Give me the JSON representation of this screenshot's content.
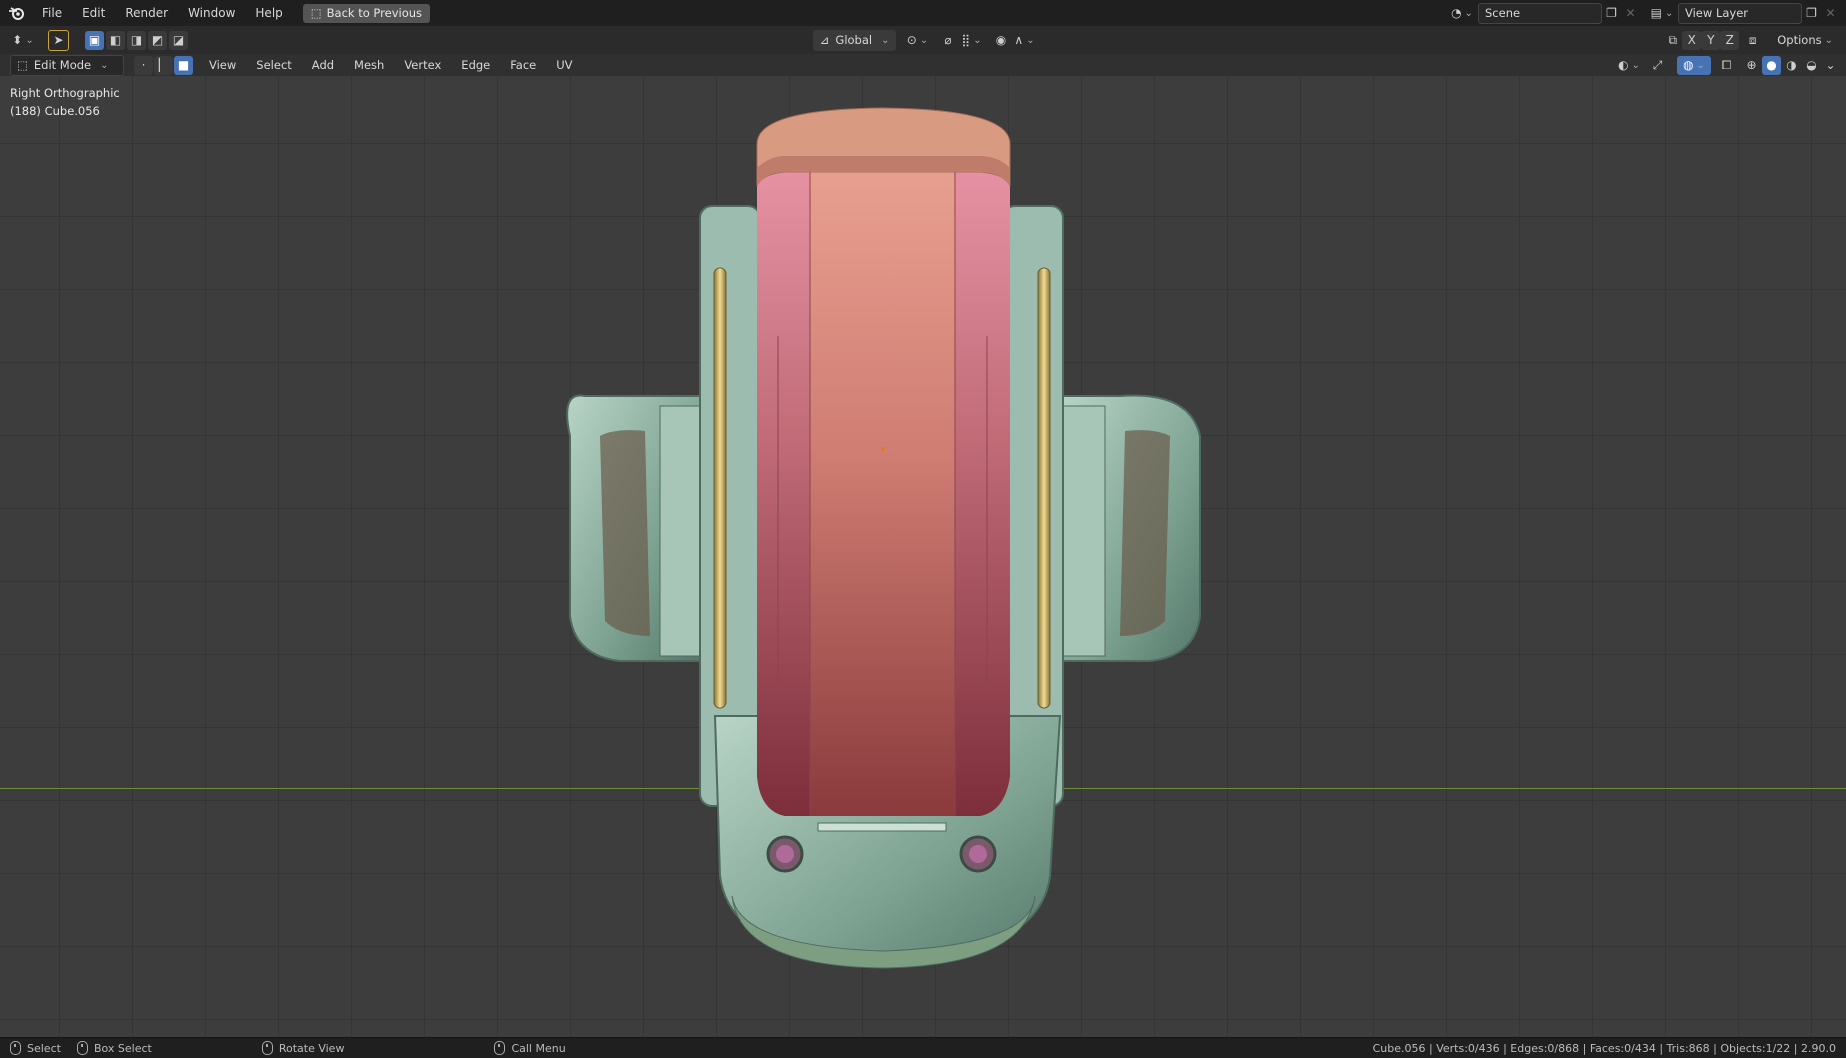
{
  "app": {
    "menus": [
      "File",
      "Edit",
      "Render",
      "Window",
      "Help"
    ],
    "back_button": "Back to Previous",
    "scene_label": "Scene",
    "view_layer_label": "View Layer"
  },
  "toolbar": {
    "orientation": "Global",
    "axes": [
      "X",
      "Y",
      "Z"
    ],
    "options_label": "Options"
  },
  "viewport_header": {
    "mode": "Edit Mode",
    "menus": [
      "View",
      "Select",
      "Add",
      "Mesh",
      "Vertex",
      "Edge",
      "Face",
      "UV"
    ]
  },
  "viewport": {
    "view_name": "Right Orthographic",
    "object_info": "(188) Cube.056",
    "colors": {
      "background": "#3d3d3d",
      "grid": "#353535",
      "y_axis": "#6f8f3a",
      "wheel_body": "#c2706e",
      "housing": "#9fbfb0",
      "rails": "#c9b06a"
    }
  },
  "statusbar": {
    "hints": [
      {
        "key": "left-mouse",
        "label": "Select"
      },
      {
        "key": "left-drag",
        "label": "Box Select"
      },
      {
        "key": "middle-mouse",
        "label": "Rotate View"
      },
      {
        "key": "right-mouse",
        "label": "Call Menu"
      }
    ],
    "stats": "Cube.056 | Verts:0/436 | Edges:0/868 | Faces:0/434 | Tris:868 | Objects:1/22 | 2.90.0"
  }
}
